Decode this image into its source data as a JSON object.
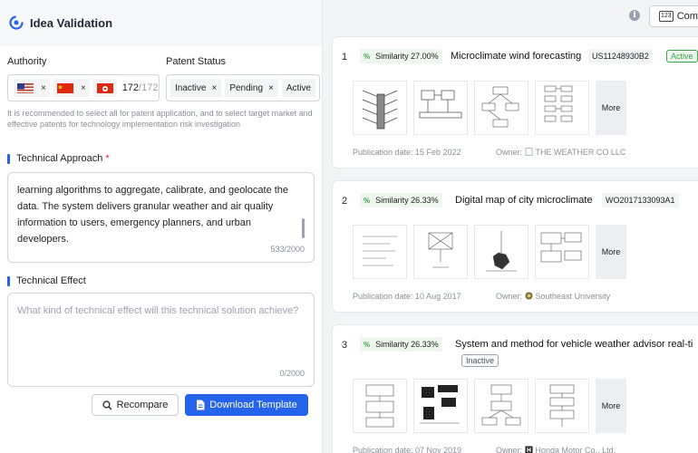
{
  "app": {
    "title": "Idea Validation"
  },
  "filters": {
    "authority_label": "Authority",
    "patent_status_label": "Patent Status",
    "authority_chips": [
      {
        "flag": "US-flag",
        "remove": "×"
      },
      {
        "flag": "CN-flag",
        "remove": "×"
      },
      {
        "flag": "HK-flag",
        "remove": ""
      }
    ],
    "authority_count": "172",
    "authority_max": "/172",
    "status_chips": [
      {
        "label": "Inactive",
        "remove": "×"
      },
      {
        "label": "Pending",
        "remove": "×"
      },
      {
        "label": "Active",
        "remove": ""
      }
    ],
    "hint": "It is recommended to select all for patent application, and to select target market and effective patents for technology implementation risk investigation"
  },
  "technical_approach": {
    "label": "Technical Approach",
    "required_mark": "*",
    "text": "learning algorithms to aggregate, calibrate, and geolocate the data. The system delivers granular weather and air quality information to users, emergency planners, and urban developers.",
    "count": "533/2000"
  },
  "technical_effect": {
    "label": "Technical Effect",
    "placeholder": "What kind of technical effect will this technical solution achieve?",
    "count": "0/2000"
  },
  "actions": {
    "recompare": "Recompare",
    "download": "Download Template"
  },
  "right": {
    "info_icon": "info-icon",
    "compare_label": "Com",
    "compare_num": "123"
  },
  "results": [
    {
      "rank": "1",
      "similarity": "Similarity 27.00%",
      "title": "Microclimate wind forecasting",
      "number": "US11248930B2",
      "status": "Active",
      "more": "More",
      "pub_date": "Publication date: 15 Feb 2022",
      "owner_label": "Owner:",
      "owner": "THE WEATHER CO LLC"
    },
    {
      "rank": "2",
      "similarity": "Similarity 26.33%",
      "title": "Digital map of city microclimate",
      "number": "WO2017133093A1",
      "status": "",
      "more": "More",
      "pub_date": "Publication date: 10 Aug 2017",
      "owner_label": "Owner:",
      "owner": "Southeast University"
    },
    {
      "rank": "3",
      "similarity": "Similarity 26.33%",
      "title": "System and method for vehicle weather advisor real-ti",
      "number": "",
      "status": "Inactive",
      "more": "More",
      "pub_date": "Publication date: 07 Nov 2019",
      "owner_label": "Owner:",
      "owner": "Honda Motor Co., Ltd."
    }
  ]
}
